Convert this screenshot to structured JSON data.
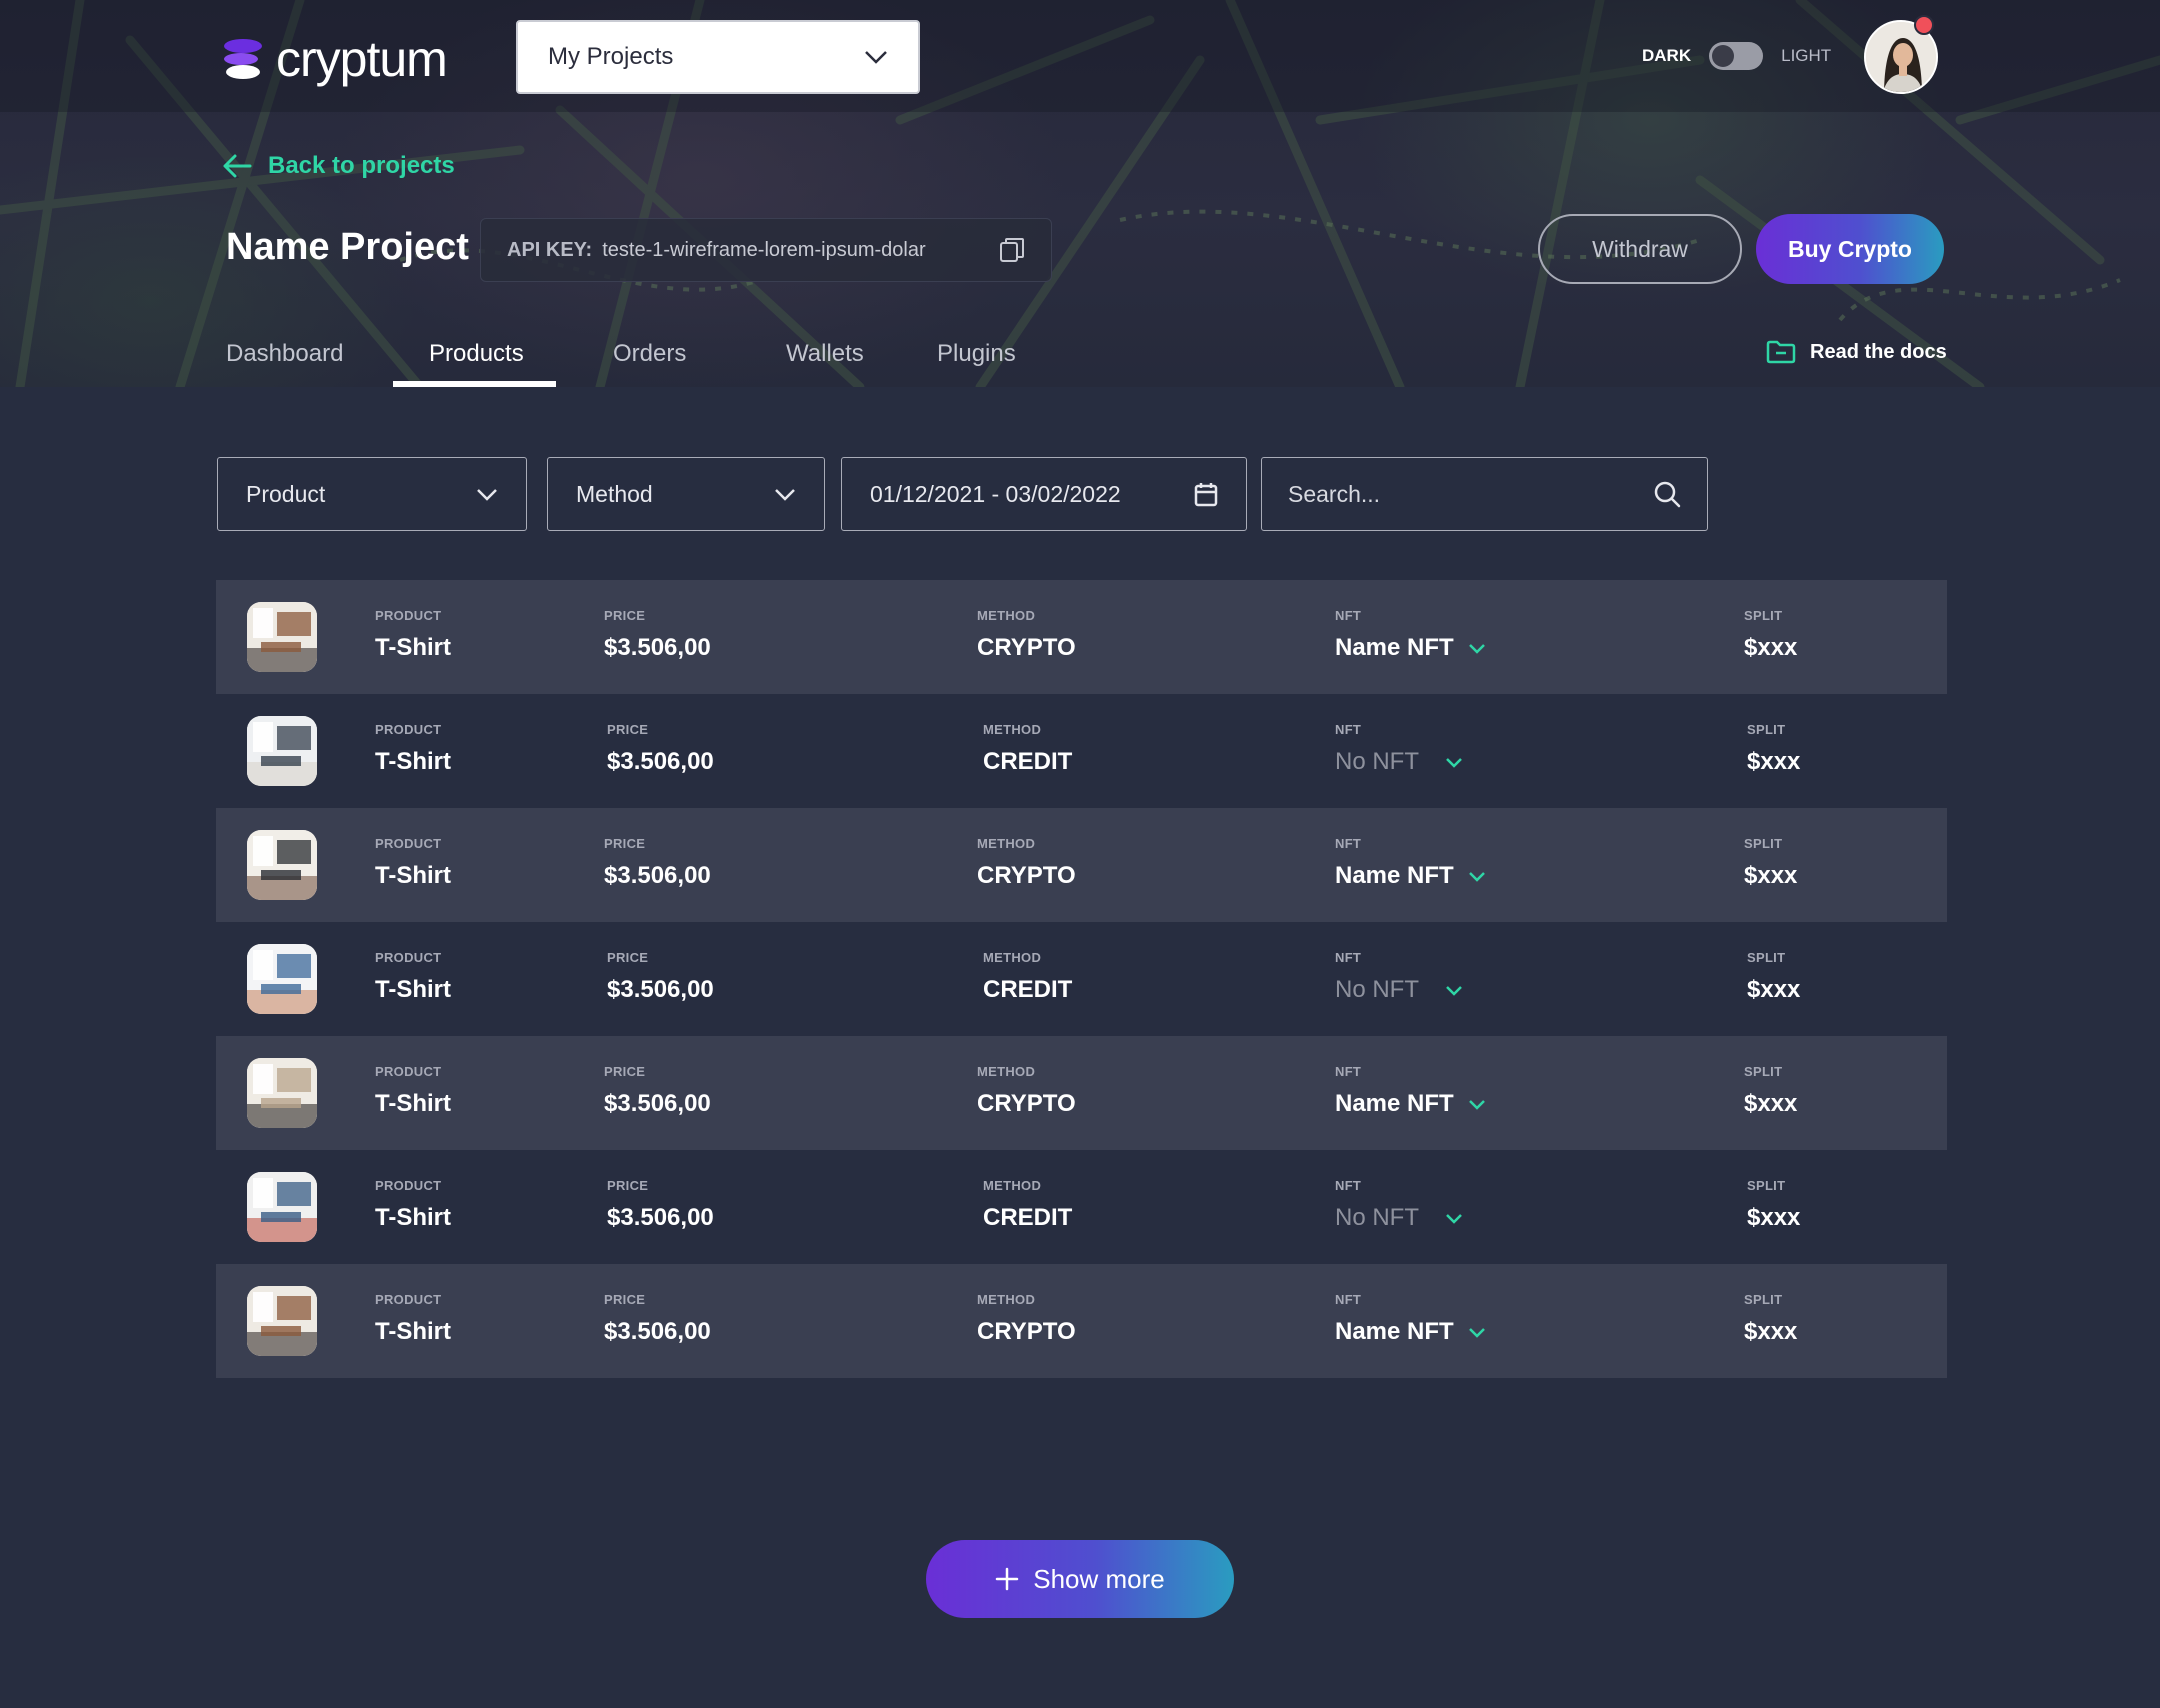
{
  "brand": {
    "name": "cryptum"
  },
  "header": {
    "project_select": "My Projects",
    "theme": {
      "dark_label": "DARK",
      "light_label": "LIGHT"
    },
    "avatar_icon": "user-avatar",
    "notification_color": "#f0505a"
  },
  "nav": {
    "back_label": "Back to projects"
  },
  "project": {
    "name": "Name Project",
    "api_key_label": "API KEY:",
    "api_key_value": "teste-1-wireframe-lorem-ipsum-dolar"
  },
  "actions": {
    "withdraw": "Withdraw",
    "buy": "Buy Crypto"
  },
  "tabs": [
    "Dashboard",
    "Products",
    "Orders",
    "Wallets",
    "Plugins"
  ],
  "active_tab": "Products",
  "docs_label": "Read the docs",
  "filters": {
    "product": "Product",
    "method": "Method",
    "date_range": "01/12/2021 - 03/02/2022",
    "search_placeholder": "Search..."
  },
  "columns": {
    "product": "PRODUCT",
    "price": "PRICE",
    "method": "METHOD",
    "nft": "NFT",
    "split": "SPLIT"
  },
  "rows": [
    {
      "product": "T-Shirt",
      "price": "$3.506,00",
      "method": "CRYPTO",
      "nft": "Name NFT",
      "split": "$xxx"
    },
    {
      "product": "T-Shirt",
      "price": "$3.506,00",
      "method": "CREDIT",
      "nft": "No NFT",
      "split": "$xxx"
    },
    {
      "product": "T-Shirt",
      "price": "$3.506,00",
      "method": "CRYPTO",
      "nft": "Name NFT",
      "split": "$xxx"
    },
    {
      "product": "T-Shirt",
      "price": "$3.506,00",
      "method": "CREDIT",
      "nft": "No NFT",
      "split": "$xxx"
    },
    {
      "product": "T-Shirt",
      "price": "$3.506,00",
      "method": "CRYPTO",
      "nft": "Name NFT",
      "split": "$xxx"
    },
    {
      "product": "T-Shirt",
      "price": "$3.506,00",
      "method": "CREDIT",
      "nft": "No NFT",
      "split": "$xxx"
    },
    {
      "product": "T-Shirt",
      "price": "$3.506,00",
      "method": "CRYPTO",
      "nft": "Name NFT",
      "split": "$xxx"
    }
  ],
  "show_more": "Show more",
  "colors": {
    "accent_green": "#2fd6a6",
    "gradient_start": "#6a2fd6",
    "gradient_end": "#2a9cc0",
    "background": "#272d40",
    "row_shade": "#3a3f51"
  }
}
